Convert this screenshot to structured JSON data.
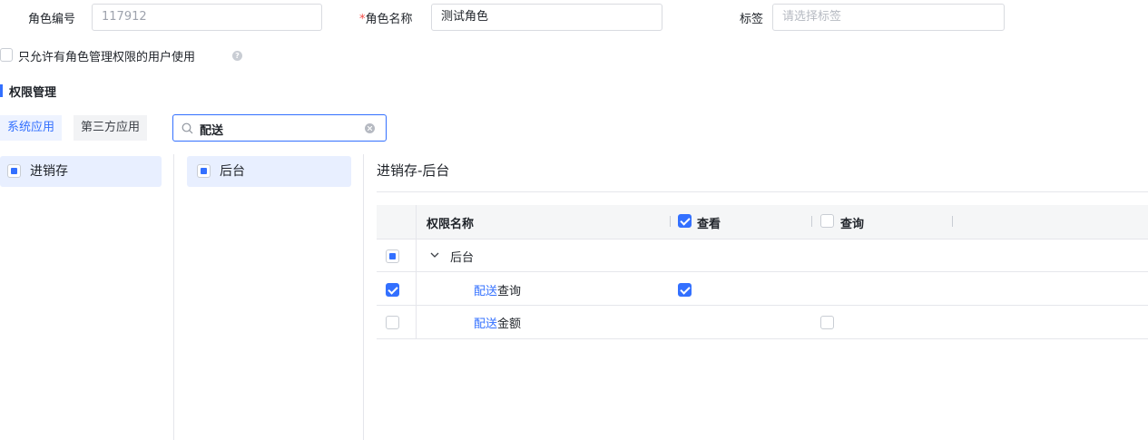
{
  "form": {
    "role_id_label": "角色编号",
    "role_id_value": "117912",
    "role_name_required_mark": "*",
    "role_name_label": "角色名称",
    "role_name_value": "测试角色",
    "tag_label": "标签",
    "tag_placeholder": "请选择标签",
    "restrict_label": "只允许有角色管理权限的用户使用"
  },
  "section": {
    "title": "权限管理"
  },
  "tabs": [
    {
      "label": "系统应用",
      "active": true
    },
    {
      "label": "第三方应用",
      "active": false
    }
  ],
  "search": {
    "value": "配送"
  },
  "apps": [
    {
      "label": "进销存",
      "state": "partial"
    }
  ],
  "modules": [
    {
      "label": "后台",
      "state": "partial"
    }
  ],
  "panel": {
    "title": "进销存-后台",
    "columns": {
      "name": "权限名称",
      "view": "查看",
      "query": "查询"
    },
    "group": {
      "label": "后台"
    },
    "rows": [
      {
        "highlight": "配送",
        "rest": "查询",
        "row_checked": true,
        "view_checked": true
      },
      {
        "highlight": "配送",
        "rest": "金额",
        "row_checked": false,
        "query_checked": false
      }
    ]
  },
  "colors": {
    "accent": "#3370ff",
    "required": "#f54a45",
    "selected_bg": "#e8efff"
  }
}
